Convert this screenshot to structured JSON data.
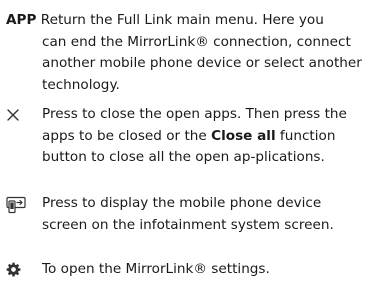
{
  "entries": [
    {
      "key": "APP",
      "line1": "Return the Full Link main menu. Here you",
      "rest": "can end the MirrorLink® connection, connect another mobile phone device or select another technology."
    },
    {
      "icon": "close-x-icon",
      "text_before": "Press to close the open apps. Then press the apps to be closed or the ",
      "bold": "Close all",
      "text_after": " function button to close all the open ap-plications."
    },
    {
      "icon": "phone-projection-icon",
      "text": "Press to display the mobile phone device screen on the infotainment system screen."
    },
    {
      "icon": "gear-icon",
      "text": "To open the MirrorLink® settings."
    }
  ]
}
